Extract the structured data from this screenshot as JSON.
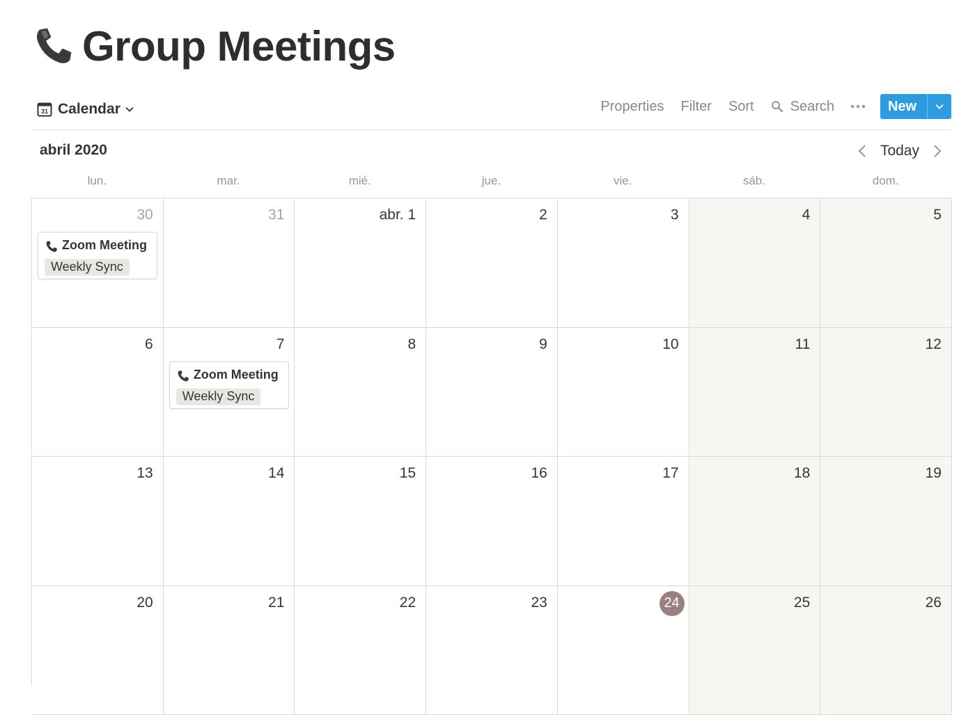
{
  "page": {
    "title": "Group Meetings",
    "icon": "telephone-icon"
  },
  "toolbar": {
    "view_label": "Calendar",
    "properties_label": "Properties",
    "filter_label": "Filter",
    "sort_label": "Sort",
    "search_label": "Search",
    "new_label": "New",
    "accent_color": "#2e9be0"
  },
  "calendar": {
    "month_label": "abril 2020",
    "today_label": "Today",
    "weekdays": [
      "lun.",
      "mar.",
      "mié.",
      "jue.",
      "vie.",
      "sáb.",
      "dom."
    ],
    "weeks": [
      [
        {
          "day": "30",
          "muted": true,
          "weekend": false
        },
        {
          "day": "31",
          "muted": true,
          "weekend": false
        },
        {
          "day": "abr. 1",
          "muted": false,
          "weekend": false
        },
        {
          "day": "2",
          "muted": false,
          "weekend": false
        },
        {
          "day": "3",
          "muted": false,
          "weekend": false
        },
        {
          "day": "4",
          "muted": false,
          "weekend": true
        },
        {
          "day": "5",
          "muted": false,
          "weekend": true
        }
      ],
      [
        {
          "day": "6",
          "muted": false,
          "weekend": false
        },
        {
          "day": "7",
          "muted": false,
          "weekend": false
        },
        {
          "day": "8",
          "muted": false,
          "weekend": false
        },
        {
          "day": "9",
          "muted": false,
          "weekend": false
        },
        {
          "day": "10",
          "muted": false,
          "weekend": false
        },
        {
          "day": "11",
          "muted": false,
          "weekend": true
        },
        {
          "day": "12",
          "muted": false,
          "weekend": true
        }
      ],
      [
        {
          "day": "13",
          "muted": false,
          "weekend": false
        },
        {
          "day": "14",
          "muted": false,
          "weekend": false
        },
        {
          "day": "15",
          "muted": false,
          "weekend": false
        },
        {
          "day": "16",
          "muted": false,
          "weekend": false
        },
        {
          "day": "17",
          "muted": false,
          "weekend": false
        },
        {
          "day": "18",
          "muted": false,
          "weekend": true
        },
        {
          "day": "19",
          "muted": false,
          "weekend": true
        }
      ],
      [
        {
          "day": "20",
          "muted": false,
          "weekend": false
        },
        {
          "day": "21",
          "muted": false,
          "weekend": false
        },
        {
          "day": "22",
          "muted": false,
          "weekend": false
        },
        {
          "day": "23",
          "muted": false,
          "weekend": false
        },
        {
          "day": "24",
          "muted": false,
          "weekend": false,
          "today": true
        },
        {
          "day": "25",
          "muted": false,
          "weekend": true
        },
        {
          "day": "26",
          "muted": false,
          "weekend": true
        }
      ]
    ],
    "events": [
      {
        "title": "Zoom Meeting",
        "tag": "Weekly Sync",
        "week": 0,
        "weekday": 0,
        "icon": "telephone-icon"
      },
      {
        "title": "Zoom Meeting",
        "tag": "Weekly Sync",
        "week": 1,
        "weekday": 1,
        "icon": "telephone-icon"
      }
    ],
    "today_color": "#9a7f81"
  }
}
